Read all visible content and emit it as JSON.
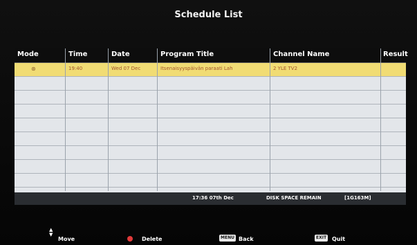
{
  "screen": {
    "title": "Schedule List"
  },
  "table": {
    "headers": [
      "Mode",
      "Time",
      "Date",
      "Program Title",
      "Channel Name",
      "Result"
    ],
    "rows": [
      {
        "mode_icon": "recording-icon",
        "time": "19:40",
        "date": "Wed  07 Dec",
        "program_title": "Itsenaisyyspäivän paraati Lah",
        "channel_name": "2  YLE TV2",
        "result": "",
        "selected": true
      },
      {
        "mode_icon": "",
        "time": "",
        "date": "",
        "program_title": "",
        "channel_name": "",
        "result": "",
        "selected": false
      },
      {
        "mode_icon": "",
        "time": "",
        "date": "",
        "program_title": "",
        "channel_name": "",
        "result": "",
        "selected": false
      },
      {
        "mode_icon": "",
        "time": "",
        "date": "",
        "program_title": "",
        "channel_name": "",
        "result": "",
        "selected": false
      },
      {
        "mode_icon": "",
        "time": "",
        "date": "",
        "program_title": "",
        "channel_name": "",
        "result": "",
        "selected": false
      },
      {
        "mode_icon": "",
        "time": "",
        "date": "",
        "program_title": "",
        "channel_name": "",
        "result": "",
        "selected": false
      },
      {
        "mode_icon": "",
        "time": "",
        "date": "",
        "program_title": "",
        "channel_name": "",
        "result": "",
        "selected": false
      },
      {
        "mode_icon": "",
        "time": "",
        "date": "",
        "program_title": "",
        "channel_name": "",
        "result": "",
        "selected": false
      },
      {
        "mode_icon": "",
        "time": "",
        "date": "",
        "program_title": "",
        "channel_name": "",
        "result": "",
        "selected": false
      },
      {
        "mode_icon": "",
        "time": "",
        "date": "",
        "program_title": "",
        "channel_name": "",
        "result": "",
        "selected": false
      }
    ]
  },
  "status": {
    "clock": "17:36   07th Dec",
    "disk_label": "DISK SPACE REMAIN",
    "disk_value": "[1G163M]"
  },
  "footer": {
    "move_label": "Move",
    "delete_label": "Delete",
    "menu_key": "MENU",
    "back_label": "Back",
    "exit_key": "EXIT",
    "quit_label": "Quit"
  },
  "colors": {
    "selected_row": "#f1dc74",
    "row": "#e3e6ea",
    "header_bar": "#0d0d0d",
    "delete_dot": "#e23a3a"
  }
}
